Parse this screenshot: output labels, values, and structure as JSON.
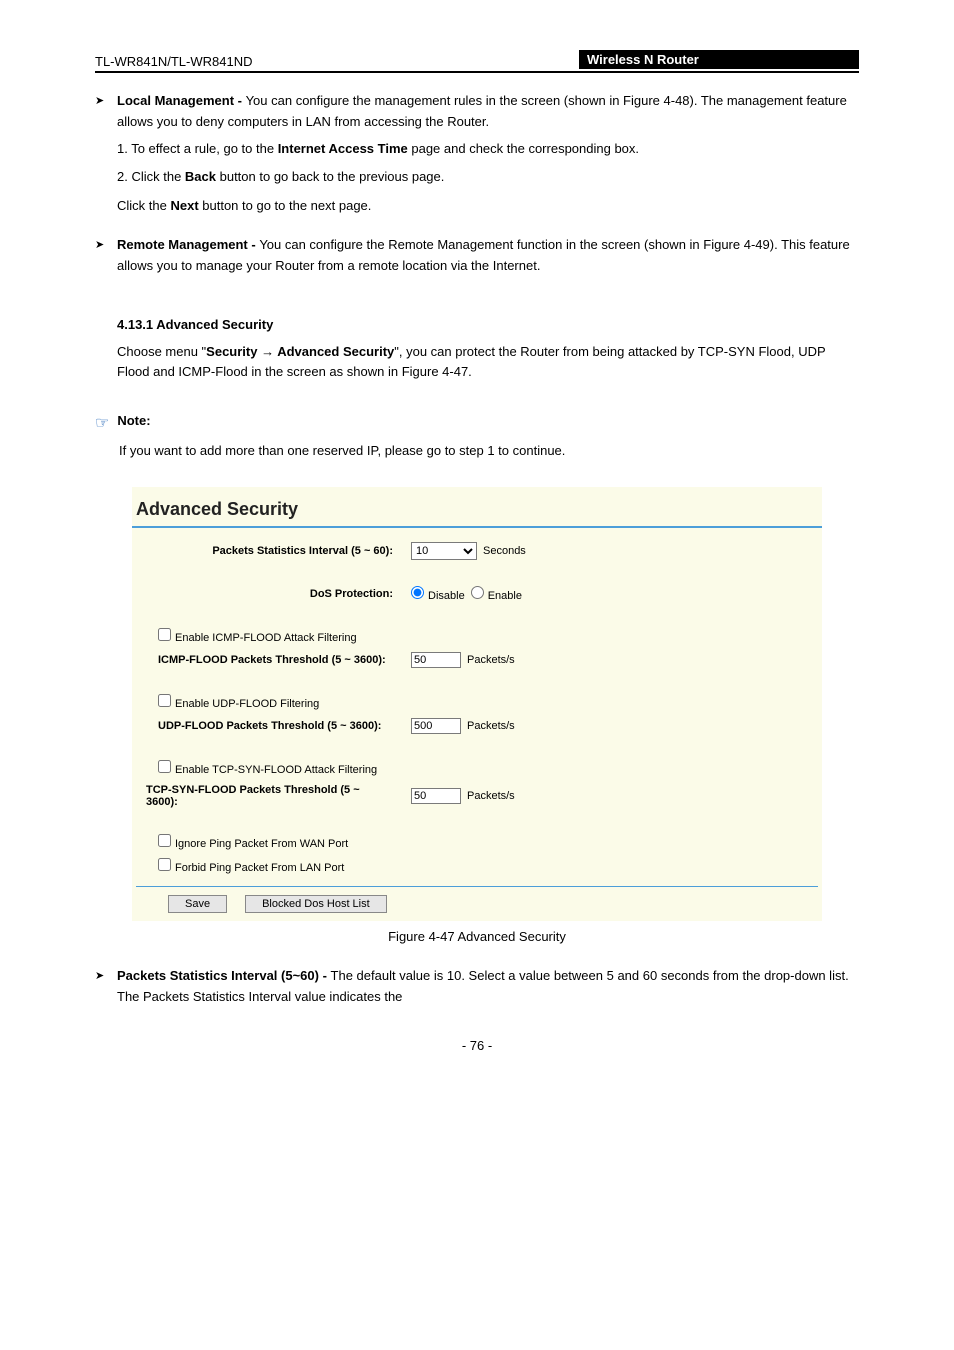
{
  "header": {
    "left": "TL-WR841N/TL-WR841ND",
    "right": "Wireless N Router"
  },
  "bullets": {
    "local_label": "Local Management - ",
    "local_body": "You can configure the management rules in the screen (shown in Figure 4-48). The management feature allows you to deny computers in LAN from accessing the Router.",
    "remote_label": "Remote Management - ",
    "remote_body": "You can configure the Remote Management function in the screen (shown in Figure 4-49). This feature allows you to manage your Router from a remote location via the Internet."
  },
  "section": {
    "heading": "4.13.1 Advanced Security",
    "intro_pre": "Choose menu \"",
    "intro_menu": "Security → Advanced Security",
    "intro_post": "\", you can protect the Router from being attacked by TCP-SYN Flood, UDP Flood and ICMP-Flood in the screen as shown in Figure 4-47."
  },
  "steps": {
    "s1_pre": "1. To effect a rule, go to the ",
    "s1_strong": "Internet Access Time",
    "s1_post": " page and check the corresponding box.",
    "s2_pre": "2. Click the ",
    "s2_strong": "Back",
    "s2_post": " button to go back to the previous page.",
    "s3_pre": "Click the ",
    "s3_strong": "Next",
    "s3_post": " button to go to the next page."
  },
  "note": {
    "label": "Note:",
    "body": "If you want to add more than one reserved IP, please go to step 1 to continue."
  },
  "ui": {
    "title": "Advanced Security",
    "stats_label": "Packets Statistics Interval (5 ~ 60):",
    "stats_value": "10",
    "stats_unit": "Seconds",
    "dos_label": "DoS Protection:",
    "dos_disable": "Disable",
    "dos_enable": "Enable",
    "icmp_enable": "Enable ICMP-FLOOD Attack Filtering",
    "icmp_label": "ICMP-FLOOD Packets Threshold (5 ~ 3600):",
    "icmp_value": "50",
    "icmp_unit": "Packets/s",
    "udp_enable": "Enable UDP-FLOOD Filtering",
    "udp_label": "UDP-FLOOD Packets Threshold (5 ~ 3600):",
    "udp_value": "500",
    "udp_unit": "Packets/s",
    "tcp_enable": "Enable TCP-SYN-FLOOD Attack Filtering",
    "tcp_label": "TCP-SYN-FLOOD Packets Threshold (5 ~ 3600):",
    "tcp_value": "50",
    "tcp_unit": "Packets/s",
    "ignore_wan": "Ignore Ping Packet From WAN Port",
    "forbid_lan": "Forbid Ping Packet From LAN Port",
    "save": "Save",
    "blocked": "Blocked Dos Host List"
  },
  "figcap": "Figure 4-47 Advanced Security",
  "last_bullet": {
    "label": "Packets Statistics Interval (5~60) - ",
    "body": "The default value is 10. Select a value between 5 and 60 seconds from the drop-down list. The Packets Statistics Interval value indicates the"
  },
  "page_number": "- 76 -"
}
